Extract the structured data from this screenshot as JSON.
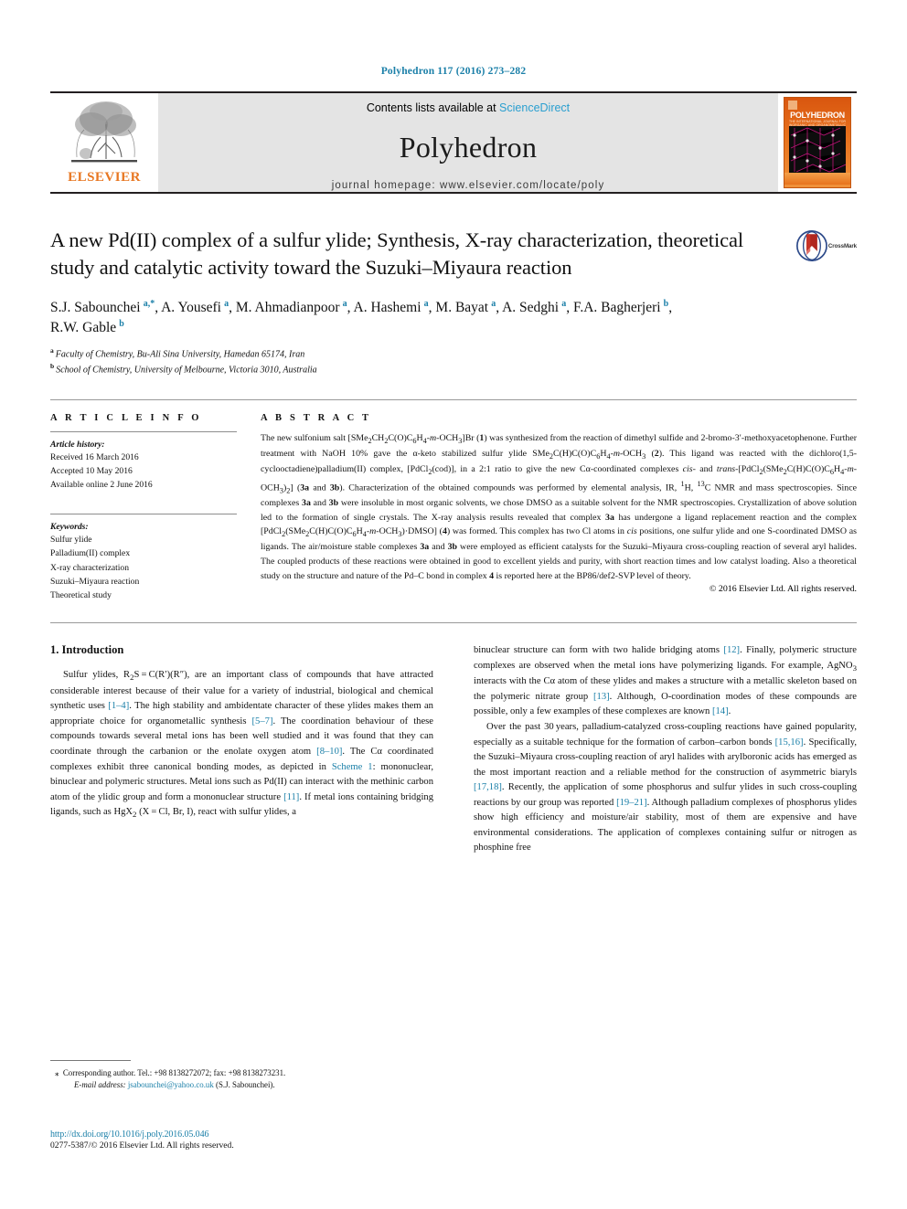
{
  "citation": "Polyhedron 117 (2016) 273–282",
  "masthead": {
    "publisher": "ELSEVIER",
    "contents_prefix": "Contents lists available at ",
    "contents_link": "ScienceDirect",
    "journal": "Polyhedron",
    "homepage": "journal homepage: www.elsevier.com/locate/poly",
    "cover_title": "POLYHEDRON",
    "cover_subtitle": "THE INTERNATIONAL JOURNAL FOR INORGANIC AND ORGANOMETALLIC CHEMISTRY"
  },
  "article": {
    "title": "A new Pd(II) complex of a sulfur ylide; Synthesis, X-ray characterization, theoretical study and catalytic activity toward the Suzuki–Miyaura reaction",
    "crossmark_label": "CrossMark",
    "authors_html": "S.J. Sabounchei <sup>a,*</sup>, A. Yousefi <sup>a</sup>, M. Ahmadianpoor <sup>a</sup>, A. Hashemi <sup>a</sup>, M. Bayat <sup>a</sup>, A. Sedghi <sup>a</sup>, F.A. Bagherjeri <sup>b</sup>, R.W. Gable <sup>b</sup>",
    "affiliations": [
      {
        "marker": "a",
        "text": "Faculty of Chemistry, Bu-Ali Sina University, Hamedan 65174, Iran"
      },
      {
        "marker": "b",
        "text": "School of Chemistry, University of Melbourne, Victoria 3010, Australia"
      }
    ]
  },
  "info": {
    "heading": "A R T I C L E   I N F O",
    "history_label": "Article history:",
    "history": [
      "Received 16 March 2016",
      "Accepted 10 May 2016",
      "Available online 2 June 2016"
    ],
    "keywords_label": "Keywords:",
    "keywords": [
      "Sulfur ylide",
      "Palladium(II) complex",
      "X-ray characterization",
      "Suzuki–Miyaura reaction",
      "Theoretical study"
    ]
  },
  "abstract": {
    "heading": "A B S T R A C T",
    "copyright": "© 2016 Elsevier Ltd. All rights reserved."
  },
  "intro": {
    "heading": "1. Introduction"
  },
  "footnotes": {
    "corresponding": "Corresponding author. Tel.: +98 8138272072; fax: +98 8138273231.",
    "email_label": "E-mail address:",
    "email": "jsabounchei@yahoo.co.uk",
    "email_suffix": "(S.J. Sabounchei).",
    "doi": "http://dx.doi.org/10.1016/j.poly.2016.05.046",
    "issn": "0277-5387/© 2016 Elsevier Ltd. All rights reserved."
  },
  "colors": {
    "link": "#1a7fa8",
    "elsevier_orange": "#e87722",
    "band_gray": "#e4e4e4"
  }
}
